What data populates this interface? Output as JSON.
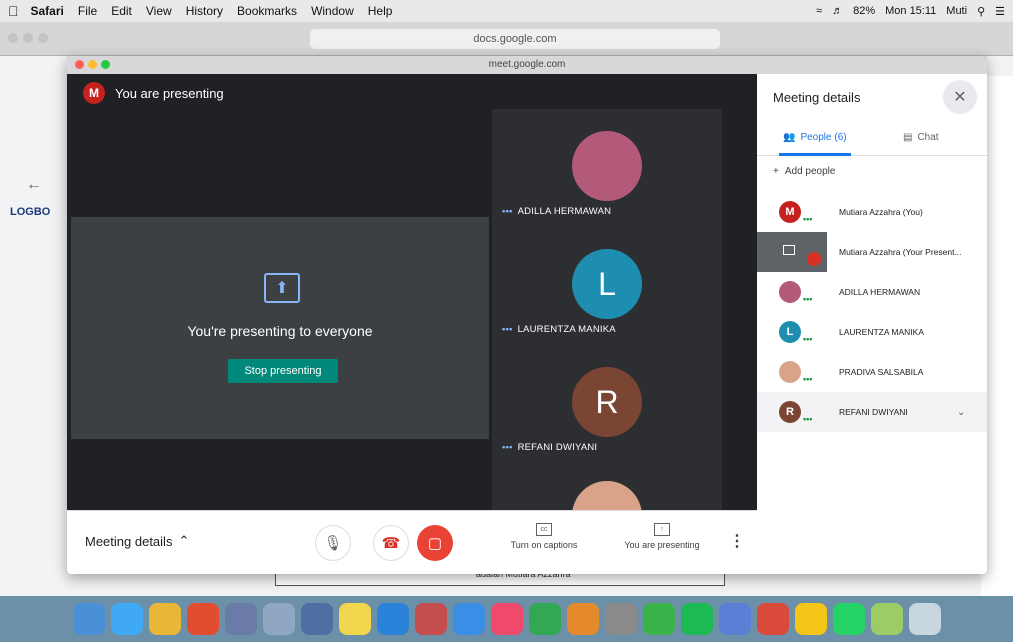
{
  "menubar": {
    "apple": "",
    "app": "Safari",
    "items": [
      "File",
      "Edit",
      "View",
      "History",
      "Bookmarks",
      "Window",
      "Help"
    ],
    "battery": "82%",
    "clock": "Mon 15:11",
    "user": "Muti"
  },
  "safari": {
    "url": "docs.google.com"
  },
  "docs": {
    "section": "LOGBO",
    "table_text": "adalah Mutiara Azzahra"
  },
  "meet": {
    "url": "meet.google.com",
    "presenting_label": "You are presenting",
    "self_initial": "M",
    "present_message": "You're presenting to everyone",
    "stop_label": "Stop presenting",
    "tiles": [
      {
        "name": "ADILLA HERMAWAN",
        "initial": "",
        "color": "#b35a7a"
      },
      {
        "name": "LAURENTZA MANIKA",
        "initial": "L",
        "color": "#1e8eb0"
      },
      {
        "name": "REFANI DWIYANI",
        "initial": "R",
        "color": "#7a4633"
      }
    ],
    "bottombar": {
      "meeting_details": "Meeting details",
      "captions_label": "Turn on captions",
      "presenting_label": "You are presenting"
    },
    "details": {
      "title": "Meeting details",
      "tab_people": "People (6)",
      "tab_chat": "Chat",
      "add_people": "Add people",
      "people": [
        {
          "name": "Mutiara Azzahra (You)",
          "initial": "M",
          "color": "#c5221f"
        },
        {
          "name": "Mutiara Azzahra (Your Present...",
          "initial": "",
          "color": "#5f6368"
        },
        {
          "name": "ADILLA HERMAWAN",
          "initial": "",
          "color": "#b35a7a"
        },
        {
          "name": "LAURENTZA MANIKA",
          "initial": "L",
          "color": "#1e8eb0"
        },
        {
          "name": "PRADIVA SALSABILA",
          "initial": "",
          "color": "#d9a38a"
        },
        {
          "name": "REFANI DWIYANI",
          "initial": "R",
          "color": "#7a4633"
        }
      ]
    }
  }
}
